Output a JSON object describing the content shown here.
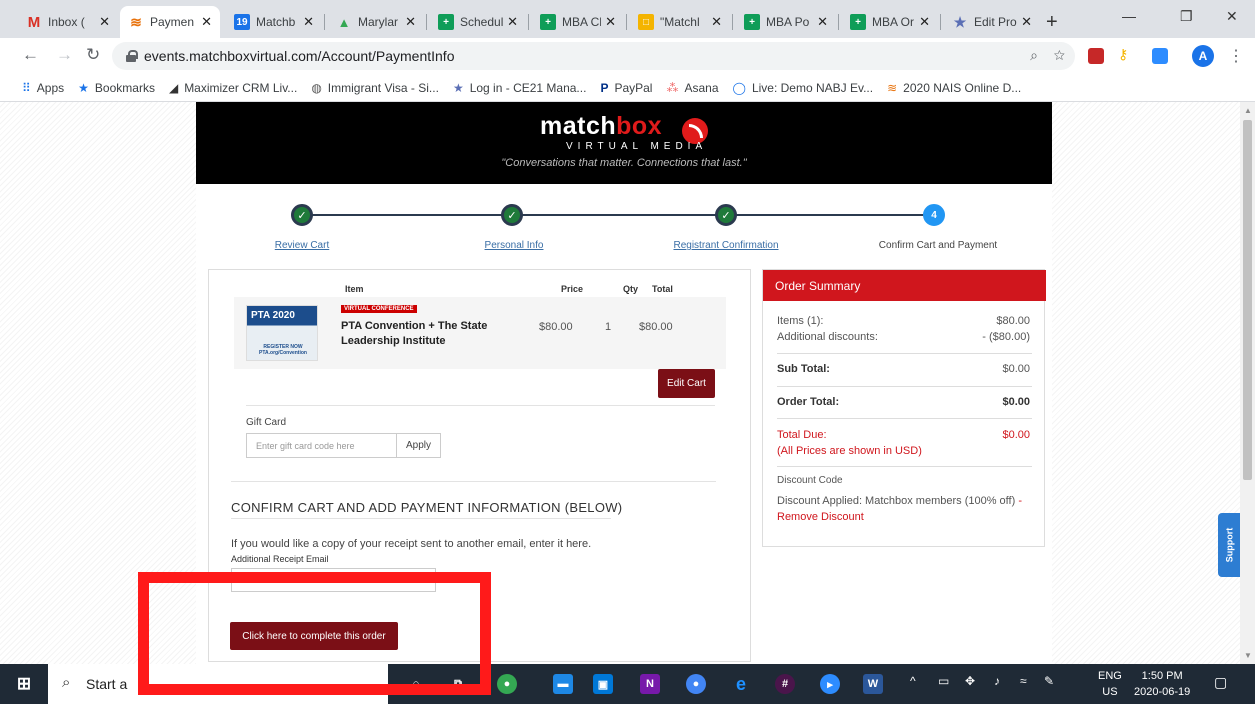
{
  "browser": {
    "tabs": [
      {
        "label": "Inbox (",
        "icon": "gmail-icon",
        "color": "#d93025",
        "glyph": "M",
        "active": false
      },
      {
        "label": "Paymen",
        "icon": "matchbox-icon",
        "color": "#e8710a",
        "glyph": "≡",
        "active": true
      },
      {
        "label": "Matchb",
        "icon": "calendar-icon",
        "color": "#1a73e8",
        "glyph": "19",
        "active": false
      },
      {
        "label": "Marylar",
        "icon": "drive-icon",
        "color": "#34a853",
        "glyph": "▲",
        "active": false
      },
      {
        "label": "Schedul",
        "icon": "sheets-icon",
        "color": "#0f9d58",
        "glyph": "+",
        "active": false
      },
      {
        "label": "MBA Cl",
        "icon": "sheets-icon",
        "color": "#0f9d58",
        "glyph": "+",
        "active": false
      },
      {
        "label": "\"Matchl",
        "icon": "slides-icon",
        "color": "#f4b400",
        "glyph": "□",
        "active": false
      },
      {
        "label": "MBA Po",
        "icon": "sheets-icon",
        "color": "#0f9d58",
        "glyph": "+",
        "active": false
      },
      {
        "label": "MBA Or",
        "icon": "sheets-icon",
        "color": "#0f9d58",
        "glyph": "+",
        "active": false
      },
      {
        "label": "Edit Pro",
        "icon": "century21-icon",
        "color": "#5b6fb5",
        "glyph": "★",
        "active": false
      }
    ],
    "url": "events.matchboxvirtual.com/Account/PaymentInfo",
    "avatar_letter": "A",
    "bookmarks": [
      {
        "label": "Apps",
        "icon": "apps-icon"
      },
      {
        "label": "Bookmarks",
        "icon": "star-icon"
      },
      {
        "label": "Maximizer CRM Liv...",
        "icon": "maximizer-icon"
      },
      {
        "label": "Immigrant Visa - Si...",
        "icon": "globe-icon"
      },
      {
        "label": "Log in - CE21 Mana...",
        "icon": "ce21-icon"
      },
      {
        "label": "PayPal",
        "icon": "paypal-icon"
      },
      {
        "label": "Asana",
        "icon": "asana-icon"
      },
      {
        "label": "Live: Demo NABJ Ev...",
        "icon": "circle-icon"
      },
      {
        "label": "2020 NAIS Online D...",
        "icon": "matchbox-icon"
      }
    ]
  },
  "header": {
    "logo_main": "match",
    "logo_box": "box",
    "logo_sub": "VIRTUAL MEDIA",
    "tagline": "\"Conversations that matter. Connections that last.\""
  },
  "steps": [
    {
      "label": "Review Cart",
      "done": true
    },
    {
      "label": "Personal Info",
      "done": true
    },
    {
      "label": "Registrant Confirmation",
      "done": true
    },
    {
      "label": "Confirm Cart and Payment",
      "done": false,
      "number": "4"
    }
  ],
  "cart": {
    "headers": {
      "item": "Item",
      "price": "Price",
      "qty": "Qty",
      "total": "Total"
    },
    "item": {
      "badge": "VIRTUAL CONFERENCE",
      "name": "PTA Convention + The State Leadership Institute",
      "price": "$80.00",
      "qty": "1",
      "total": "$80.00",
      "thumb_title": "PTA 2020",
      "thumb_caption": "REGISTER NOW PTA.org/Convention"
    },
    "edit_label": "Edit Cart",
    "gift_label": "Gift Card",
    "gift_placeholder": "Enter gift card code here",
    "apply_label": "Apply",
    "section_title": "CONFIRM CART AND ADD PAYMENT INFORMATION (BELOW)",
    "receipt_text": "If you would like a copy of your receipt sent to another email, enter it here.",
    "receipt_label": "Additional Receipt Email",
    "complete_label": "Click here to complete this order"
  },
  "summary": {
    "title": "Order Summary",
    "items_label": "Items (1):",
    "items_value": "$80.00",
    "discounts_label": "Additional discounts:",
    "discounts_value": "- ($80.00)",
    "subtotal_label": "Sub Total:",
    "subtotal_value": "$0.00",
    "total_label": "Order Total:",
    "total_value": "$0.00",
    "due_label": "Total Due:",
    "due_value": "$0.00",
    "currency_note": "(All Prices are shown in USD)",
    "discount_code_label": "Discount Code",
    "discount_applied": "Discount Applied: Matchbox members (100% off)",
    "remove_label": "- Remove Discount"
  },
  "support_label": "Support",
  "taskbar": {
    "search_text": "Start a",
    "lang": "ENG",
    "region": "US",
    "time": "1:50 PM",
    "date": "2020-06-19"
  },
  "colors": {
    "accent_red": "#d0161d",
    "button_dark": "#7b0f16",
    "step_blue": "#2196f3",
    "highlight": "#ff1a1a"
  }
}
